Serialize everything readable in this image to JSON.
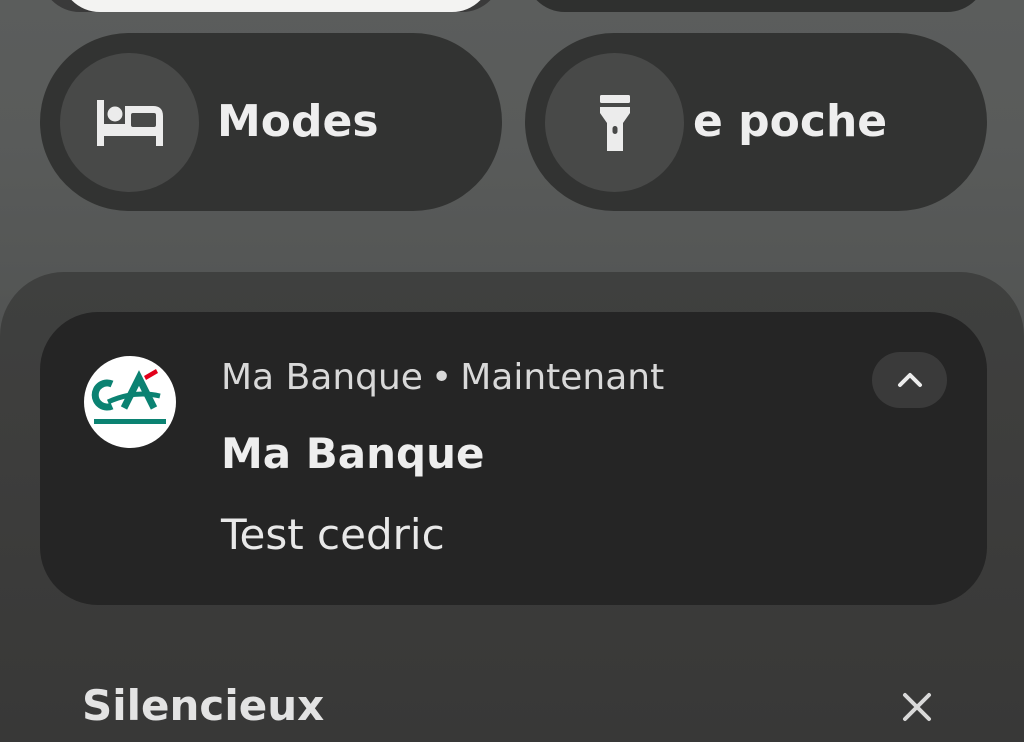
{
  "quick_settings": {
    "tiles": [
      {
        "label": "Modes",
        "icon": "bed-icon"
      },
      {
        "label": "e poche",
        "icon": "flashlight-icon"
      }
    ]
  },
  "notification": {
    "app_name": "Ma Banque",
    "separator": "•",
    "time": "Maintenant",
    "title": "Ma Banque",
    "body": "Test cedric",
    "app_icon": "credit-agricole-logo",
    "expand_icon": "chevron-up-icon"
  },
  "section": {
    "label": "Silencieux",
    "close_icon": "close-icon"
  },
  "colors": {
    "logo_teal": "#0b8272",
    "logo_red": "#e2001a",
    "card_background": "#252525",
    "tile_background": "#323332"
  }
}
